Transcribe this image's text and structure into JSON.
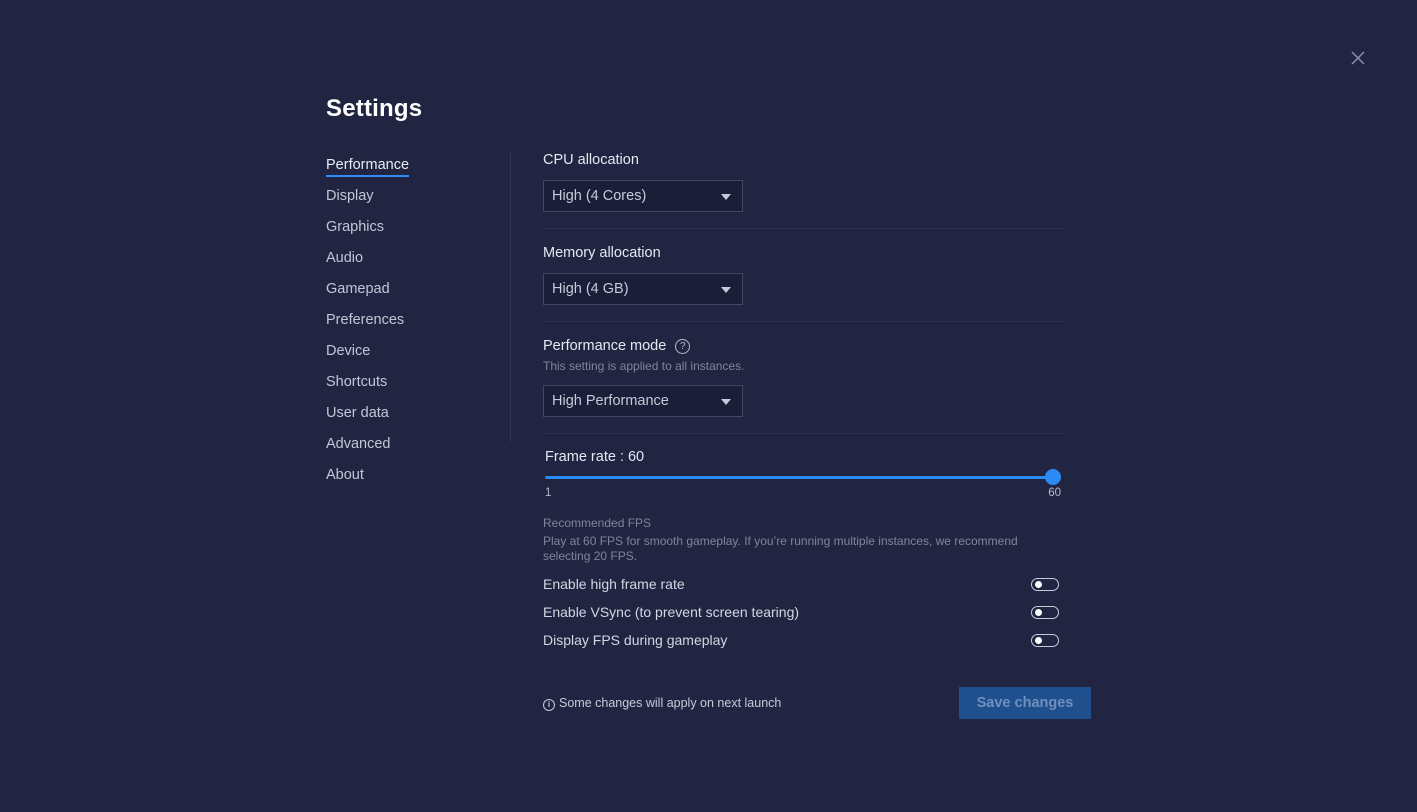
{
  "header": {
    "title": "Settings",
    "close_icon": "close-icon"
  },
  "sidebar": {
    "active": "Performance",
    "items": [
      {
        "label": "Performance"
      },
      {
        "label": "Display"
      },
      {
        "label": "Graphics"
      },
      {
        "label": "Audio"
      },
      {
        "label": "Gamepad"
      },
      {
        "label": "Preferences"
      },
      {
        "label": "Device"
      },
      {
        "label": "Shortcuts"
      },
      {
        "label": "User data"
      },
      {
        "label": "Advanced"
      },
      {
        "label": "About"
      }
    ]
  },
  "performance": {
    "cpu": {
      "label": "CPU allocation",
      "value": "High (4 Cores)"
    },
    "memory": {
      "label": "Memory allocation",
      "value": "High (4 GB)"
    },
    "mode": {
      "label": "Performance mode",
      "help_icon": "?",
      "hint": "This setting is applied to all instances.",
      "value": "High Performance"
    },
    "frame_rate": {
      "label": "Frame rate : 60",
      "value": 60,
      "min": 1,
      "max": 60,
      "min_label": "1",
      "max_label": "60"
    },
    "recommended": {
      "title": "Recommended FPS",
      "text": "Play at 60 FPS for smooth gameplay. If you’re running multiple instances, we recommend selecting 20 FPS."
    },
    "toggles": [
      {
        "label": "Enable high frame rate",
        "on": false
      },
      {
        "label": "Enable VSync (to prevent screen tearing)",
        "on": false
      },
      {
        "label": "Display FPS during gameplay",
        "on": false
      }
    ]
  },
  "footer": {
    "info_icon": "i",
    "note": "Some changes will apply on next launch",
    "save_label": "Save changes"
  },
  "colors": {
    "background": "#222542",
    "accent": "#2c8bf3",
    "save_button_bg": "#1f4f8c",
    "save_button_text": "#6e90bd"
  }
}
